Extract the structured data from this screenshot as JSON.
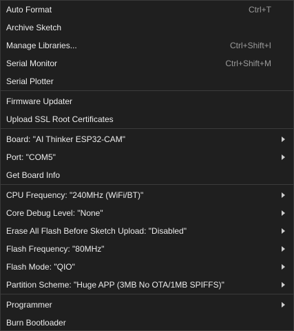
{
  "menu": {
    "items": [
      {
        "label": "Auto Format",
        "shortcut": "Ctrl+T"
      },
      {
        "label": "Archive Sketch"
      },
      {
        "label": "Manage Libraries...",
        "shortcut": "Ctrl+Shift+I"
      },
      {
        "label": "Serial Monitor",
        "shortcut": "Ctrl+Shift+M"
      },
      {
        "label": "Serial Plotter"
      },
      {
        "label": "Firmware Updater"
      },
      {
        "label": "Upload SSL Root Certificates"
      },
      {
        "label": "Board: \"AI Thinker ESP32-CAM\"",
        "arrow": "chevron-right-icon"
      },
      {
        "label": "Port: \"COM5\"",
        "arrow": "chevron-right-icon"
      },
      {
        "label": "Get Board Info"
      },
      {
        "label": "CPU Frequency: \"240MHz (WiFi/BT)\"",
        "arrow": "chevron-right-icon"
      },
      {
        "label": "Core Debug Level: \"None\"",
        "arrow": "chevron-right-icon"
      },
      {
        "label": "Erase All Flash Before Sketch Upload: \"Disabled\"",
        "arrow": "chevron-right-icon"
      },
      {
        "label": "Flash Frequency: \"80MHz\"",
        "arrow": "chevron-right-icon"
      },
      {
        "label": "Flash Mode: \"QIO\"",
        "arrow": "chevron-right-icon"
      },
      {
        "label": "Partition Scheme: \"Huge APP (3MB No OTA/1MB SPIFFS)\"",
        "arrow": "chevron-right-icon"
      },
      {
        "label": "Programmer",
        "arrow": "chevron-right-icon"
      },
      {
        "label": "Burn Bootloader"
      }
    ]
  },
  "colors": {
    "background": "#1f1f1f",
    "text": "#ececec",
    "shortcut_text": "#9b9b9b",
    "separator": "#3c3c3c"
  }
}
